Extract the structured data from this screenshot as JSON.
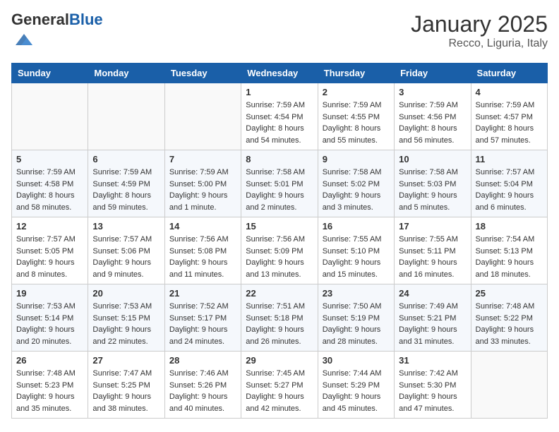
{
  "logo": {
    "general": "General",
    "blue": "Blue"
  },
  "title": "January 2025",
  "location": "Recco, Liguria, Italy",
  "days_of_week": [
    "Sunday",
    "Monday",
    "Tuesday",
    "Wednesday",
    "Thursday",
    "Friday",
    "Saturday"
  ],
  "weeks": [
    [
      {
        "day": "",
        "info": ""
      },
      {
        "day": "",
        "info": ""
      },
      {
        "day": "",
        "info": ""
      },
      {
        "day": "1",
        "info": "Sunrise: 7:59 AM\nSunset: 4:54 PM\nDaylight: 8 hours\nand 54 minutes."
      },
      {
        "day": "2",
        "info": "Sunrise: 7:59 AM\nSunset: 4:55 PM\nDaylight: 8 hours\nand 55 minutes."
      },
      {
        "day": "3",
        "info": "Sunrise: 7:59 AM\nSunset: 4:56 PM\nDaylight: 8 hours\nand 56 minutes."
      },
      {
        "day": "4",
        "info": "Sunrise: 7:59 AM\nSunset: 4:57 PM\nDaylight: 8 hours\nand 57 minutes."
      }
    ],
    [
      {
        "day": "5",
        "info": "Sunrise: 7:59 AM\nSunset: 4:58 PM\nDaylight: 8 hours\nand 58 minutes."
      },
      {
        "day": "6",
        "info": "Sunrise: 7:59 AM\nSunset: 4:59 PM\nDaylight: 8 hours\nand 59 minutes."
      },
      {
        "day": "7",
        "info": "Sunrise: 7:59 AM\nSunset: 5:00 PM\nDaylight: 9 hours\nand 1 minute."
      },
      {
        "day": "8",
        "info": "Sunrise: 7:58 AM\nSunset: 5:01 PM\nDaylight: 9 hours\nand 2 minutes."
      },
      {
        "day": "9",
        "info": "Sunrise: 7:58 AM\nSunset: 5:02 PM\nDaylight: 9 hours\nand 3 minutes."
      },
      {
        "day": "10",
        "info": "Sunrise: 7:58 AM\nSunset: 5:03 PM\nDaylight: 9 hours\nand 5 minutes."
      },
      {
        "day": "11",
        "info": "Sunrise: 7:57 AM\nSunset: 5:04 PM\nDaylight: 9 hours\nand 6 minutes."
      }
    ],
    [
      {
        "day": "12",
        "info": "Sunrise: 7:57 AM\nSunset: 5:05 PM\nDaylight: 9 hours\nand 8 minutes."
      },
      {
        "day": "13",
        "info": "Sunrise: 7:57 AM\nSunset: 5:06 PM\nDaylight: 9 hours\nand 9 minutes."
      },
      {
        "day": "14",
        "info": "Sunrise: 7:56 AM\nSunset: 5:08 PM\nDaylight: 9 hours\nand 11 minutes."
      },
      {
        "day": "15",
        "info": "Sunrise: 7:56 AM\nSunset: 5:09 PM\nDaylight: 9 hours\nand 13 minutes."
      },
      {
        "day": "16",
        "info": "Sunrise: 7:55 AM\nSunset: 5:10 PM\nDaylight: 9 hours\nand 15 minutes."
      },
      {
        "day": "17",
        "info": "Sunrise: 7:55 AM\nSunset: 5:11 PM\nDaylight: 9 hours\nand 16 minutes."
      },
      {
        "day": "18",
        "info": "Sunrise: 7:54 AM\nSunset: 5:13 PM\nDaylight: 9 hours\nand 18 minutes."
      }
    ],
    [
      {
        "day": "19",
        "info": "Sunrise: 7:53 AM\nSunset: 5:14 PM\nDaylight: 9 hours\nand 20 minutes."
      },
      {
        "day": "20",
        "info": "Sunrise: 7:53 AM\nSunset: 5:15 PM\nDaylight: 9 hours\nand 22 minutes."
      },
      {
        "day": "21",
        "info": "Sunrise: 7:52 AM\nSunset: 5:17 PM\nDaylight: 9 hours\nand 24 minutes."
      },
      {
        "day": "22",
        "info": "Sunrise: 7:51 AM\nSunset: 5:18 PM\nDaylight: 9 hours\nand 26 minutes."
      },
      {
        "day": "23",
        "info": "Sunrise: 7:50 AM\nSunset: 5:19 PM\nDaylight: 9 hours\nand 28 minutes."
      },
      {
        "day": "24",
        "info": "Sunrise: 7:49 AM\nSunset: 5:21 PM\nDaylight: 9 hours\nand 31 minutes."
      },
      {
        "day": "25",
        "info": "Sunrise: 7:48 AM\nSunset: 5:22 PM\nDaylight: 9 hours\nand 33 minutes."
      }
    ],
    [
      {
        "day": "26",
        "info": "Sunrise: 7:48 AM\nSunset: 5:23 PM\nDaylight: 9 hours\nand 35 minutes."
      },
      {
        "day": "27",
        "info": "Sunrise: 7:47 AM\nSunset: 5:25 PM\nDaylight: 9 hours\nand 38 minutes."
      },
      {
        "day": "28",
        "info": "Sunrise: 7:46 AM\nSunset: 5:26 PM\nDaylight: 9 hours\nand 40 minutes."
      },
      {
        "day": "29",
        "info": "Sunrise: 7:45 AM\nSunset: 5:27 PM\nDaylight: 9 hours\nand 42 minutes."
      },
      {
        "day": "30",
        "info": "Sunrise: 7:44 AM\nSunset: 5:29 PM\nDaylight: 9 hours\nand 45 minutes."
      },
      {
        "day": "31",
        "info": "Sunrise: 7:42 AM\nSunset: 5:30 PM\nDaylight: 9 hours\nand 47 minutes."
      },
      {
        "day": "",
        "info": ""
      }
    ]
  ]
}
